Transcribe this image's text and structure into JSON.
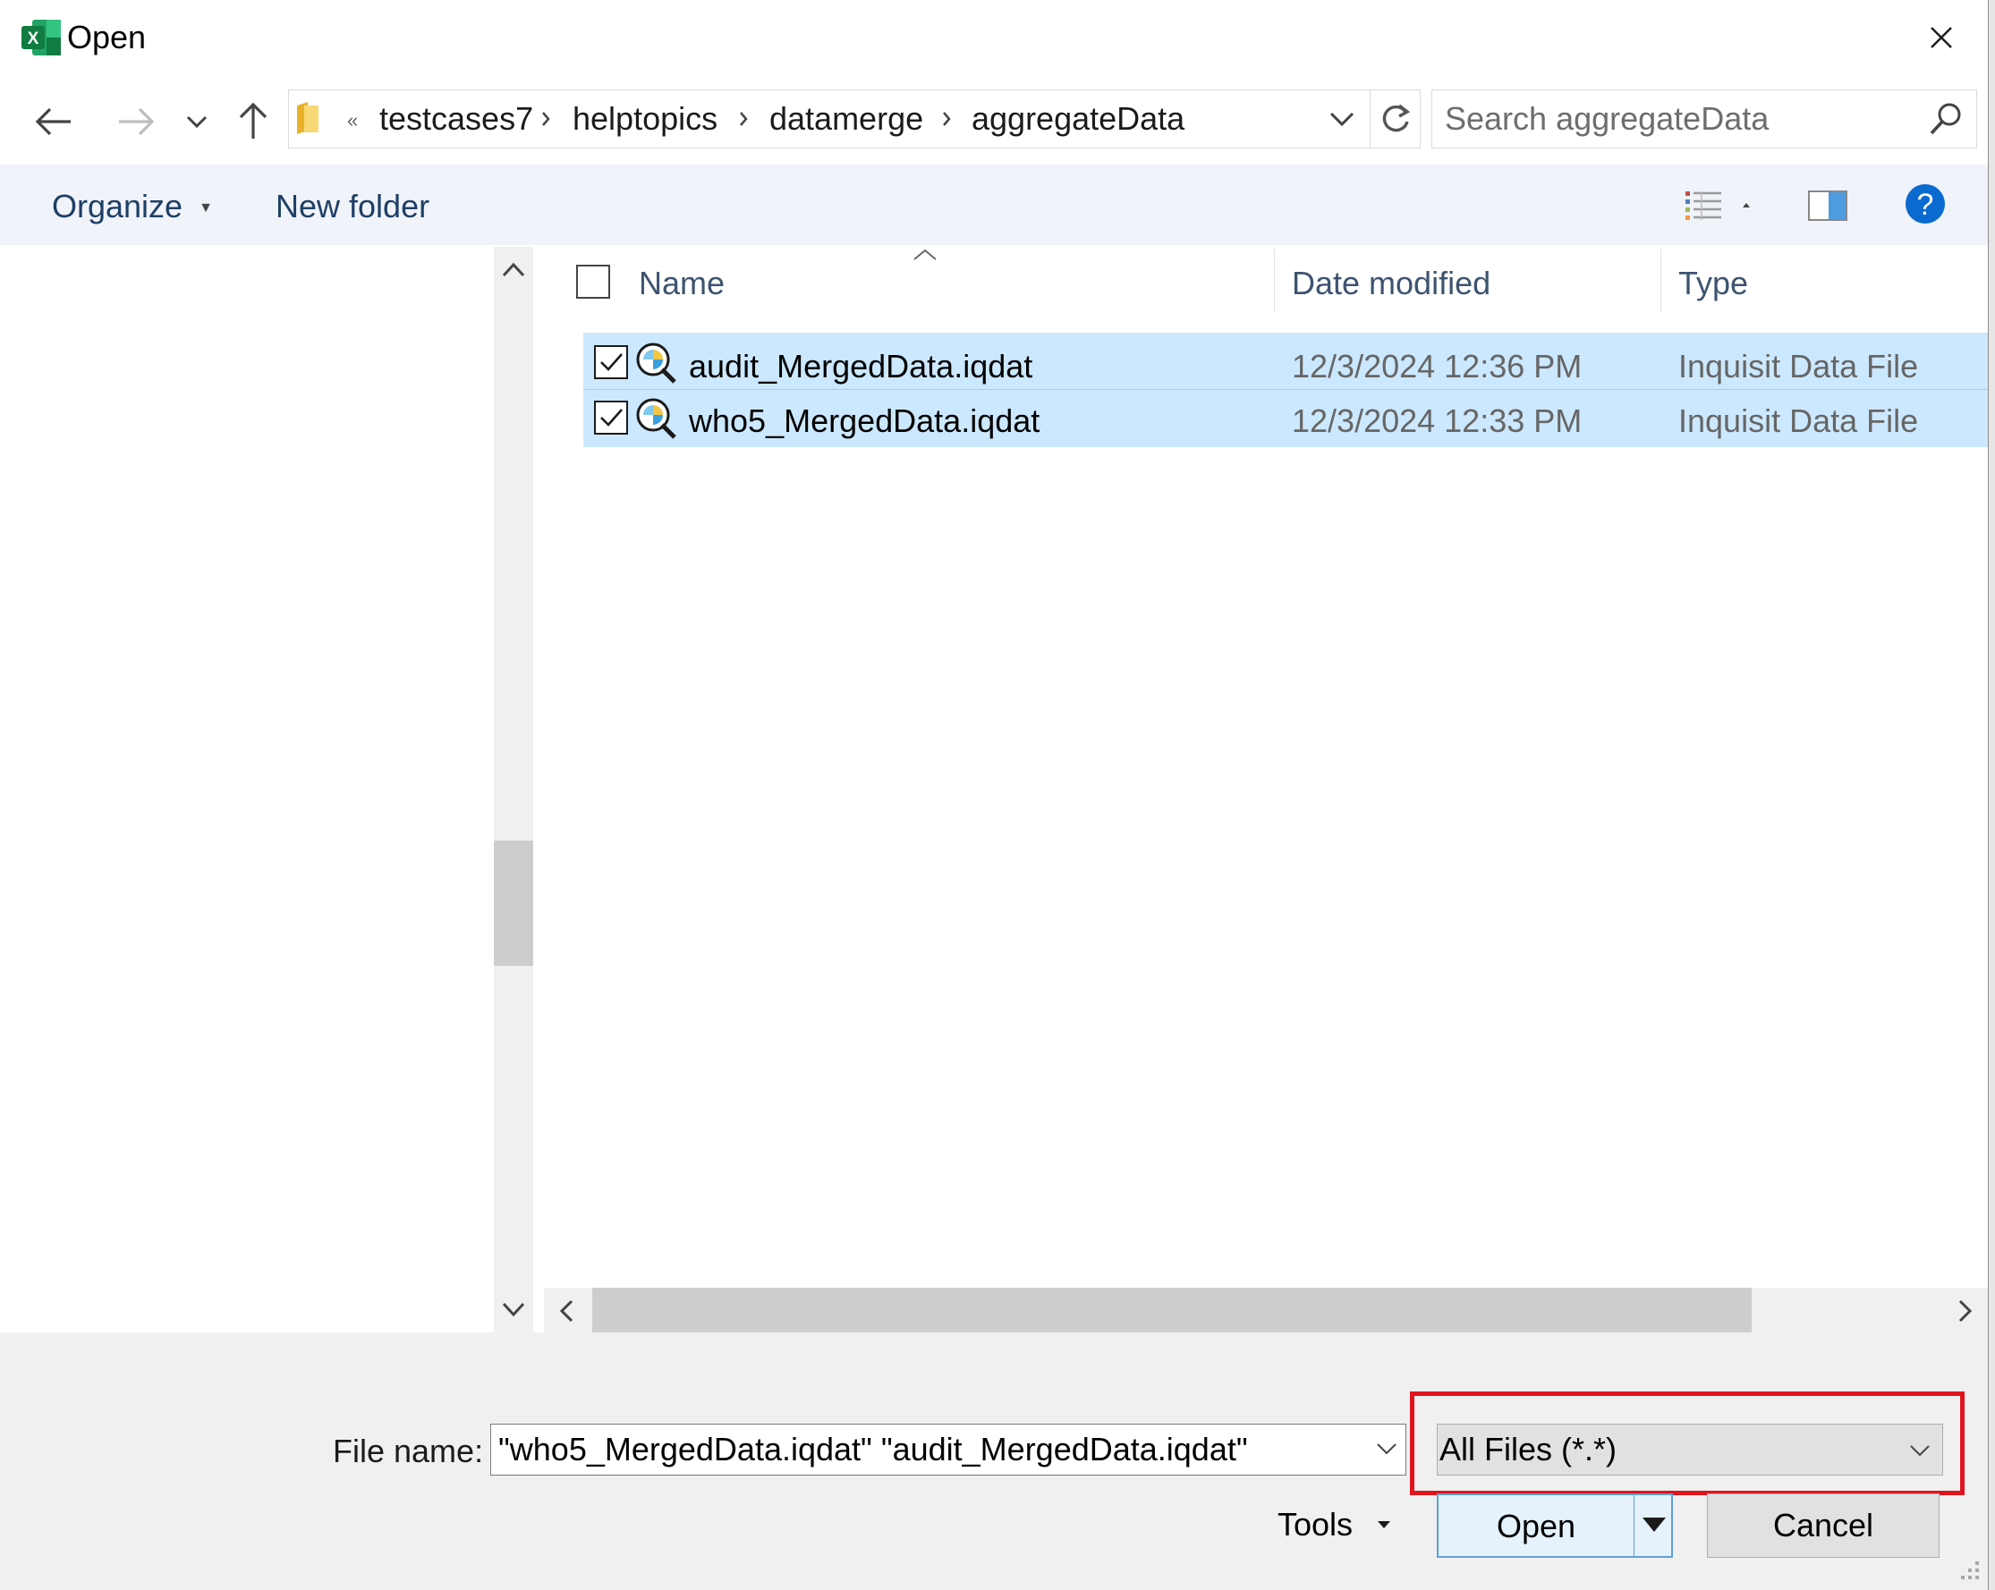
{
  "window": {
    "title": "Open"
  },
  "address": {
    "overflow_glyph": "«",
    "crumbs": [
      "testcases7",
      "helptopics",
      "datamerge",
      "aggregateData"
    ]
  },
  "search": {
    "placeholder": "Search aggregateData"
  },
  "commands": {
    "organize": "Organize",
    "new_folder": "New folder"
  },
  "columns": {
    "name": "Name",
    "date": "Date modified",
    "type": "Type"
  },
  "files": [
    {
      "name": "audit_MergedData.iqdat",
      "date": "12/3/2024 12:36 PM",
      "type": "Inquisit Data File",
      "checked": true
    },
    {
      "name": "who5_MergedData.iqdat",
      "date": "12/3/2024 12:33 PM",
      "type": "Inquisit Data File",
      "checked": true
    }
  ],
  "footer": {
    "filename_label": "File name:",
    "filename_value": "\"who5_MergedData.iqdat\" \"audit_MergedData.iqdat\"",
    "filetype": "All Files (*.*)",
    "tools": "Tools",
    "open": "Open",
    "cancel": "Cancel"
  },
  "icons": {
    "app": "excel-icon",
    "close": "close-icon",
    "back": "back-arrow-icon",
    "forward": "forward-arrow-icon",
    "recent": "chevron-down-icon",
    "up": "up-arrow-icon",
    "folder": "folder-icon",
    "refresh": "refresh-icon",
    "search": "search-icon",
    "view": "view-options-icon",
    "preview": "preview-pane-icon",
    "help": "help-icon",
    "file": "inquisit-file-icon"
  },
  "colors": {
    "accent": "#0078d4",
    "selection": "#cce8ff",
    "highlight_box": "#e0141c",
    "excel_green": "#107c41"
  }
}
